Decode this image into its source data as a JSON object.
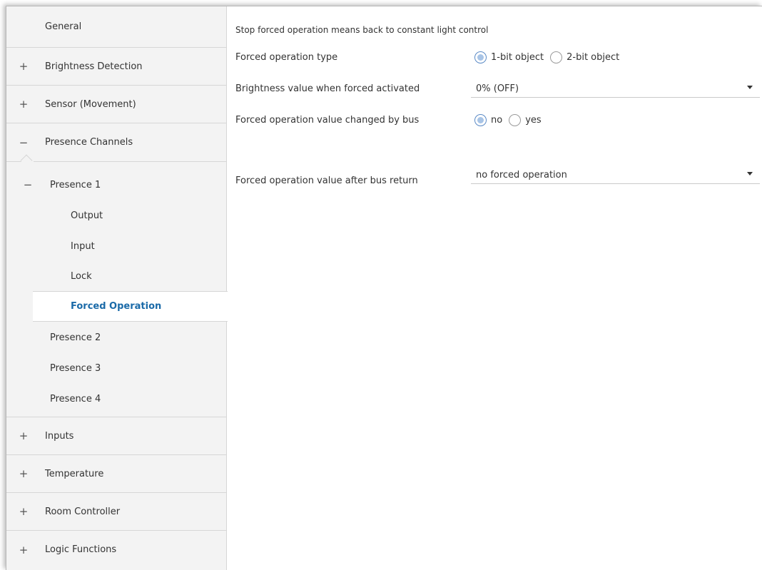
{
  "sidebar": {
    "items": [
      {
        "label": "General",
        "expander": ""
      },
      {
        "label": "Brightness Detection",
        "expander": "+"
      },
      {
        "label": "Sensor (Movement)",
        "expander": "+"
      },
      {
        "label": "Presence Channels",
        "expander": "−"
      },
      {
        "label": "Presence 1",
        "expander": "−"
      },
      {
        "label": "Output"
      },
      {
        "label": "Input"
      },
      {
        "label": "Lock"
      },
      {
        "label": "Forced Operation"
      },
      {
        "label": "Presence 2"
      },
      {
        "label": "Presence 3"
      },
      {
        "label": "Presence 4"
      },
      {
        "label": "Inputs",
        "expander": "+"
      },
      {
        "label": "Temperature",
        "expander": "+"
      },
      {
        "label": "Room Controller",
        "expander": "+"
      },
      {
        "label": "Logic Functions",
        "expander": "+"
      }
    ],
    "active": "Forced Operation"
  },
  "main": {
    "info": "Stop forced operation means back to constant light control",
    "forced_type": {
      "label": "Forced operation type",
      "options": [
        "1-bit object",
        "2-bit object"
      ],
      "selected": "1-bit object"
    },
    "brightness": {
      "label": "Brightness value when forced activated",
      "value": "0% (OFF)"
    },
    "changed_by_bus": {
      "label": "Forced operation value changed by bus",
      "options": [
        "no",
        "yes"
      ],
      "selected": "no"
    },
    "after_bus_return": {
      "label": "Forced operation value after bus return",
      "value": "no forced operation"
    }
  },
  "colors": {
    "active_text": "#1a6aa8",
    "sidebar_bg": "#f3f3f3",
    "radio_fill": "#a8c4e6"
  }
}
